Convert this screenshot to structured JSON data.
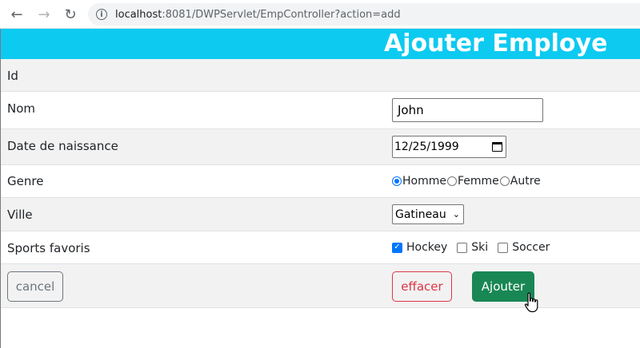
{
  "browser": {
    "url_host": "localhost",
    "url_path": ":8081/DWPServlet/EmpController?action=add"
  },
  "page": {
    "title": "Ajouter Employe"
  },
  "form": {
    "id_label": "Id",
    "nom_label": "Nom",
    "nom_value": "John",
    "dob_label": "Date de naissance",
    "dob_value": "12/25/1999",
    "genre_label": "Genre",
    "genre_options": [
      "Homme",
      "Femme",
      "Autre"
    ],
    "genre_selected": "Homme",
    "ville_label": "Ville",
    "ville_value": "Gatineau",
    "sports_label": "Sports favoris",
    "sports": [
      {
        "label": "Hockey",
        "checked": true
      },
      {
        "label": "Ski",
        "checked": false
      },
      {
        "label": "Soccer",
        "checked": false
      }
    ]
  },
  "actions": {
    "cancel": "cancel",
    "effacer": "effacer",
    "ajouter": "Ajouter"
  },
  "colors": {
    "header": "#0dcaf0",
    "success": "#198754",
    "danger": "#dc3545",
    "secondary": "#6c757d"
  }
}
